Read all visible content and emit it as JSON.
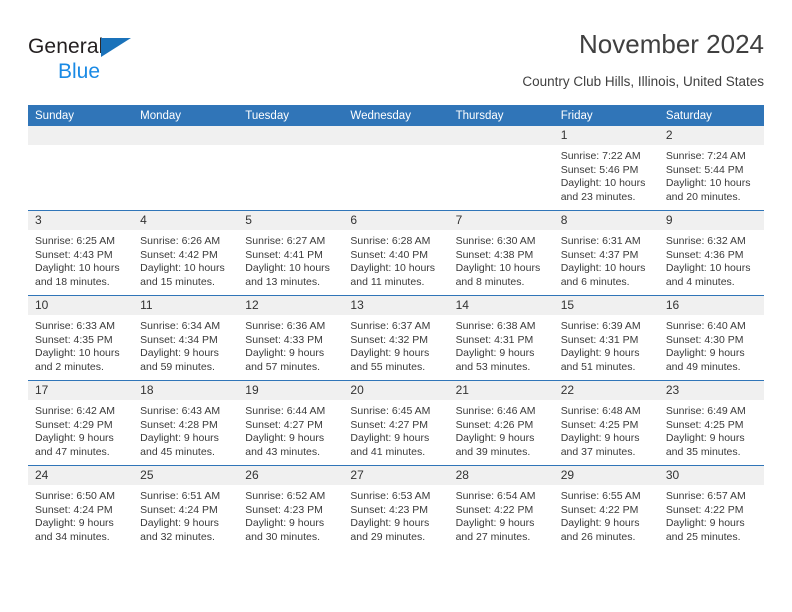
{
  "brand": {
    "name_part1": "General",
    "name_part2": "Blue",
    "triangle_color": "#1a72ba",
    "blue_color": "#1a8ae5"
  },
  "header": {
    "title": "November 2024",
    "location": "Country Club Hills, Illinois, United States"
  },
  "theme": {
    "header_blue": "#3075b8",
    "daynum_gray": "#f0f0f0"
  },
  "weekday_headers": [
    "Sunday",
    "Monday",
    "Tuesday",
    "Wednesday",
    "Thursday",
    "Friday",
    "Saturday"
  ],
  "weeks": [
    [
      {
        "day": "",
        "sunrise": "",
        "sunset": "",
        "daylight_line1": "",
        "daylight_line2": ""
      },
      {
        "day": "",
        "sunrise": "",
        "sunset": "",
        "daylight_line1": "",
        "daylight_line2": ""
      },
      {
        "day": "",
        "sunrise": "",
        "sunset": "",
        "daylight_line1": "",
        "daylight_line2": ""
      },
      {
        "day": "",
        "sunrise": "",
        "sunset": "",
        "daylight_line1": "",
        "daylight_line2": ""
      },
      {
        "day": "",
        "sunrise": "",
        "sunset": "",
        "daylight_line1": "",
        "daylight_line2": ""
      },
      {
        "day": "1",
        "sunrise": "Sunrise: 7:22 AM",
        "sunset": "Sunset: 5:46 PM",
        "daylight_line1": "Daylight: 10 hours",
        "daylight_line2": "and 23 minutes."
      },
      {
        "day": "2",
        "sunrise": "Sunrise: 7:24 AM",
        "sunset": "Sunset: 5:44 PM",
        "daylight_line1": "Daylight: 10 hours",
        "daylight_line2": "and 20 minutes."
      }
    ],
    [
      {
        "day": "3",
        "sunrise": "Sunrise: 6:25 AM",
        "sunset": "Sunset: 4:43 PM",
        "daylight_line1": "Daylight: 10 hours",
        "daylight_line2": "and 18 minutes."
      },
      {
        "day": "4",
        "sunrise": "Sunrise: 6:26 AM",
        "sunset": "Sunset: 4:42 PM",
        "daylight_line1": "Daylight: 10 hours",
        "daylight_line2": "and 15 minutes."
      },
      {
        "day": "5",
        "sunrise": "Sunrise: 6:27 AM",
        "sunset": "Sunset: 4:41 PM",
        "daylight_line1": "Daylight: 10 hours",
        "daylight_line2": "and 13 minutes."
      },
      {
        "day": "6",
        "sunrise": "Sunrise: 6:28 AM",
        "sunset": "Sunset: 4:40 PM",
        "daylight_line1": "Daylight: 10 hours",
        "daylight_line2": "and 11 minutes."
      },
      {
        "day": "7",
        "sunrise": "Sunrise: 6:30 AM",
        "sunset": "Sunset: 4:38 PM",
        "daylight_line1": "Daylight: 10 hours",
        "daylight_line2": "and 8 minutes."
      },
      {
        "day": "8",
        "sunrise": "Sunrise: 6:31 AM",
        "sunset": "Sunset: 4:37 PM",
        "daylight_line1": "Daylight: 10 hours",
        "daylight_line2": "and 6 minutes."
      },
      {
        "day": "9",
        "sunrise": "Sunrise: 6:32 AM",
        "sunset": "Sunset: 4:36 PM",
        "daylight_line1": "Daylight: 10 hours",
        "daylight_line2": "and 4 minutes."
      }
    ],
    [
      {
        "day": "10",
        "sunrise": "Sunrise: 6:33 AM",
        "sunset": "Sunset: 4:35 PM",
        "daylight_line1": "Daylight: 10 hours",
        "daylight_line2": "and 2 minutes."
      },
      {
        "day": "11",
        "sunrise": "Sunrise: 6:34 AM",
        "sunset": "Sunset: 4:34 PM",
        "daylight_line1": "Daylight: 9 hours",
        "daylight_line2": "and 59 minutes."
      },
      {
        "day": "12",
        "sunrise": "Sunrise: 6:36 AM",
        "sunset": "Sunset: 4:33 PM",
        "daylight_line1": "Daylight: 9 hours",
        "daylight_line2": "and 57 minutes."
      },
      {
        "day": "13",
        "sunrise": "Sunrise: 6:37 AM",
        "sunset": "Sunset: 4:32 PM",
        "daylight_line1": "Daylight: 9 hours",
        "daylight_line2": "and 55 minutes."
      },
      {
        "day": "14",
        "sunrise": "Sunrise: 6:38 AM",
        "sunset": "Sunset: 4:31 PM",
        "daylight_line1": "Daylight: 9 hours",
        "daylight_line2": "and 53 minutes."
      },
      {
        "day": "15",
        "sunrise": "Sunrise: 6:39 AM",
        "sunset": "Sunset: 4:31 PM",
        "daylight_line1": "Daylight: 9 hours",
        "daylight_line2": "and 51 minutes."
      },
      {
        "day": "16",
        "sunrise": "Sunrise: 6:40 AM",
        "sunset": "Sunset: 4:30 PM",
        "daylight_line1": "Daylight: 9 hours",
        "daylight_line2": "and 49 minutes."
      }
    ],
    [
      {
        "day": "17",
        "sunrise": "Sunrise: 6:42 AM",
        "sunset": "Sunset: 4:29 PM",
        "daylight_line1": "Daylight: 9 hours",
        "daylight_line2": "and 47 minutes."
      },
      {
        "day": "18",
        "sunrise": "Sunrise: 6:43 AM",
        "sunset": "Sunset: 4:28 PM",
        "daylight_line1": "Daylight: 9 hours",
        "daylight_line2": "and 45 minutes."
      },
      {
        "day": "19",
        "sunrise": "Sunrise: 6:44 AM",
        "sunset": "Sunset: 4:27 PM",
        "daylight_line1": "Daylight: 9 hours",
        "daylight_line2": "and 43 minutes."
      },
      {
        "day": "20",
        "sunrise": "Sunrise: 6:45 AM",
        "sunset": "Sunset: 4:27 PM",
        "daylight_line1": "Daylight: 9 hours",
        "daylight_line2": "and 41 minutes."
      },
      {
        "day": "21",
        "sunrise": "Sunrise: 6:46 AM",
        "sunset": "Sunset: 4:26 PM",
        "daylight_line1": "Daylight: 9 hours",
        "daylight_line2": "and 39 minutes."
      },
      {
        "day": "22",
        "sunrise": "Sunrise: 6:48 AM",
        "sunset": "Sunset: 4:25 PM",
        "daylight_line1": "Daylight: 9 hours",
        "daylight_line2": "and 37 minutes."
      },
      {
        "day": "23",
        "sunrise": "Sunrise: 6:49 AM",
        "sunset": "Sunset: 4:25 PM",
        "daylight_line1": "Daylight: 9 hours",
        "daylight_line2": "and 35 minutes."
      }
    ],
    [
      {
        "day": "24",
        "sunrise": "Sunrise: 6:50 AM",
        "sunset": "Sunset: 4:24 PM",
        "daylight_line1": "Daylight: 9 hours",
        "daylight_line2": "and 34 minutes."
      },
      {
        "day": "25",
        "sunrise": "Sunrise: 6:51 AM",
        "sunset": "Sunset: 4:24 PM",
        "daylight_line1": "Daylight: 9 hours",
        "daylight_line2": "and 32 minutes."
      },
      {
        "day": "26",
        "sunrise": "Sunrise: 6:52 AM",
        "sunset": "Sunset: 4:23 PM",
        "daylight_line1": "Daylight: 9 hours",
        "daylight_line2": "and 30 minutes."
      },
      {
        "day": "27",
        "sunrise": "Sunrise: 6:53 AM",
        "sunset": "Sunset: 4:23 PM",
        "daylight_line1": "Daylight: 9 hours",
        "daylight_line2": "and 29 minutes."
      },
      {
        "day": "28",
        "sunrise": "Sunrise: 6:54 AM",
        "sunset": "Sunset: 4:22 PM",
        "daylight_line1": "Daylight: 9 hours",
        "daylight_line2": "and 27 minutes."
      },
      {
        "day": "29",
        "sunrise": "Sunrise: 6:55 AM",
        "sunset": "Sunset: 4:22 PM",
        "daylight_line1": "Daylight: 9 hours",
        "daylight_line2": "and 26 minutes."
      },
      {
        "day": "30",
        "sunrise": "Sunrise: 6:57 AM",
        "sunset": "Sunset: 4:22 PM",
        "daylight_line1": "Daylight: 9 hours",
        "daylight_line2": "and 25 minutes."
      }
    ]
  ]
}
